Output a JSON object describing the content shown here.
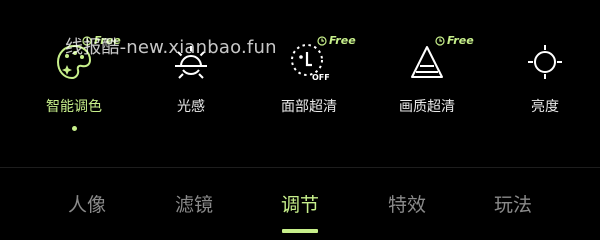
{
  "watermark": "线报酷-new.xianbao.fun",
  "badge_text": "Free",
  "accent_color": "#c7ef8b",
  "tools": [
    {
      "label": "智能调色",
      "icon": "palette-sparkle-icon",
      "active": true,
      "free": true
    },
    {
      "label": "光感",
      "icon": "sun-icon",
      "active": false,
      "free": false
    },
    {
      "label": "面部超清",
      "icon": "face-clarity-off-icon",
      "active": false,
      "free": true
    },
    {
      "label": "画质超清",
      "icon": "triangle-quality-icon",
      "active": false,
      "free": true
    },
    {
      "label": "亮度",
      "icon": "brightness-icon",
      "active": false,
      "free": false
    }
  ],
  "tabs": [
    {
      "label": "人像",
      "active": false
    },
    {
      "label": "滤镜",
      "active": false
    },
    {
      "label": "调节",
      "active": true
    },
    {
      "label": "特效",
      "active": false
    },
    {
      "label": "玩法",
      "active": false
    }
  ]
}
